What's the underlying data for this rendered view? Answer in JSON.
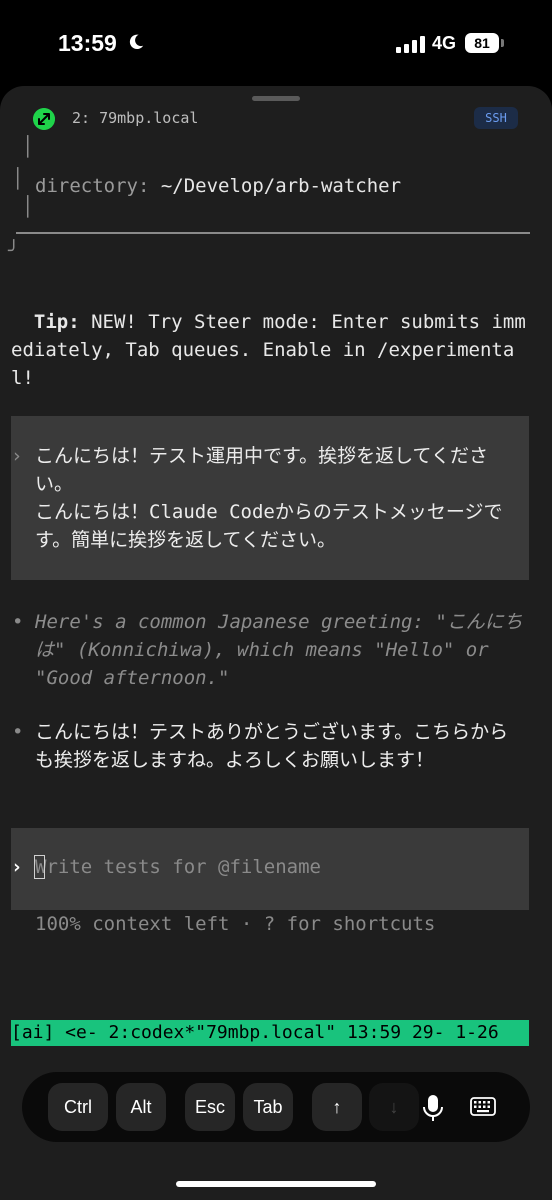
{
  "status_bar": {
    "time": "13:59",
    "network": "4G",
    "battery": "81"
  },
  "session": {
    "host": "2: 79mbp.local",
    "badge": "SSH"
  },
  "terminal": {
    "box_left_bar": "│",
    "directory_label": "directory:",
    "directory_value": "~/Develop/arb-watcher",
    "box_corner": "╯",
    "tip_label": "Tip:",
    "tip_text": " NEW! Try Steer mode: Enter submits immediately, Tab queues. Enable in /experimental!",
    "user_prompt": "›",
    "user_message": "こんにちは！テスト運用中です。挨拶を返してください。\nこんにちは！Claude Codeからのテストメッセージです。簡単に挨拶を返してください。",
    "bullet": "•",
    "response_1": "Here's a common Japanese greeting: \"こんにちは\" (Konnichiwa), which means \"Hello\" or \"Good afternoon.\"",
    "response_2": "こんにちは！テストありがとうございます。こちらからも挨拶を返しますね。よろしくお願いします！",
    "input_prompt": "›",
    "input_placeholder": "Write tests for @filename",
    "context_status": "100% context left · ? for shortcuts"
  },
  "tmux_status": "[ai] <e- 2:codex*\"79mbp.local\" 13:59 29- 1-26",
  "keyboard_bar": {
    "keys": [
      "Ctrl",
      "Alt",
      "Esc",
      "Tab"
    ],
    "up_arrow": "↑",
    "down_arrow": "↓"
  },
  "colors": {
    "tmux_bar": "#19c37d",
    "connection": "#1fd34a",
    "ssh_badge_text": "#6b9cf0"
  }
}
